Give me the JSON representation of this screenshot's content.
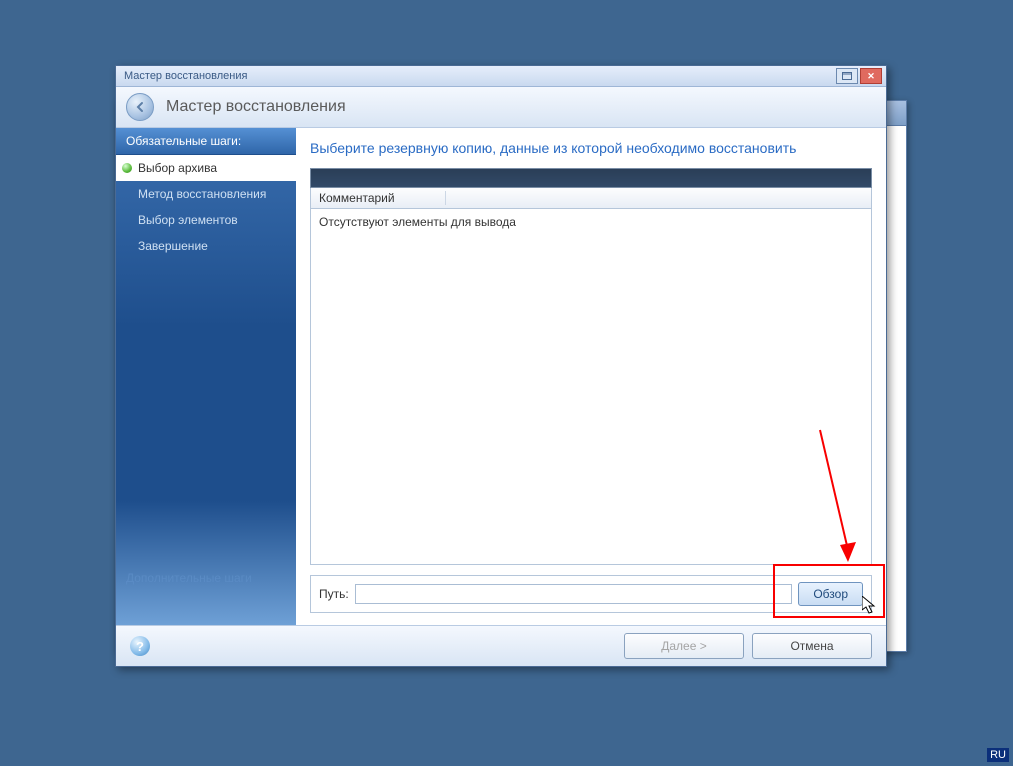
{
  "titlebar": {
    "text": "Мастер восстановления"
  },
  "header": {
    "title": "Мастер восстановления"
  },
  "sidebar": {
    "header": "Обязательные шаги:",
    "items": [
      {
        "label": "Выбор архива",
        "active": true
      },
      {
        "label": "Метод восстановления",
        "active": false
      },
      {
        "label": "Выбор элементов",
        "active": false
      },
      {
        "label": "Завершение",
        "active": false
      }
    ],
    "bottom": "Дополнительные шаги"
  },
  "main": {
    "heading": "Выберите резервную копию, данные из которой необходимо восстановить",
    "column_header": "Комментарий",
    "empty_text": "Отсутствуют элементы для вывода",
    "path_label": "Путь:",
    "path_value": "",
    "browse_label": "Обзор"
  },
  "footer": {
    "help": "?",
    "next_label": "Далее >",
    "cancel_label": "Отмена"
  },
  "lang": "RU"
}
